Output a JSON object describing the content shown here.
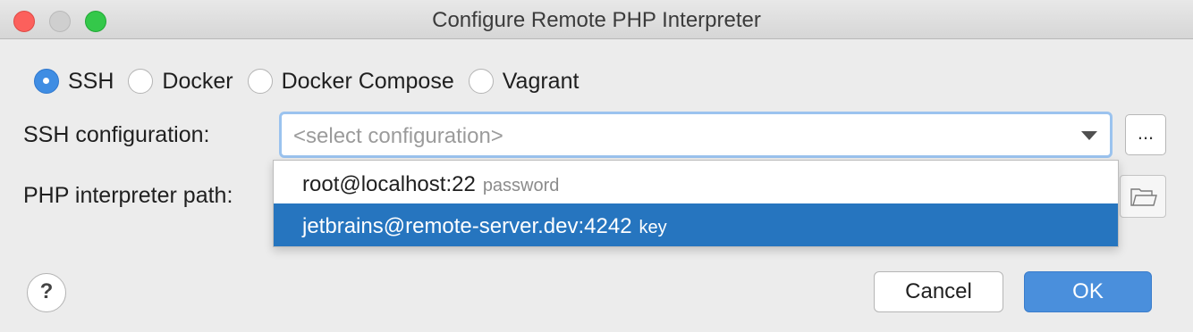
{
  "window": {
    "title": "Configure Remote PHP Interpreter"
  },
  "connection_types": {
    "options": [
      {
        "label": "SSH",
        "selected": true
      },
      {
        "label": "Docker",
        "selected": false
      },
      {
        "label": "Docker Compose",
        "selected": false
      },
      {
        "label": "Vagrant",
        "selected": false
      }
    ]
  },
  "ssh_configuration": {
    "label": "SSH configuration:",
    "placeholder": "<select configuration>",
    "browse_label": "..."
  },
  "php_interpreter": {
    "label": "PHP interpreter path:"
  },
  "dropdown": {
    "items": [
      {
        "name": "root@localhost:22",
        "auth": "password",
        "highlighted": false
      },
      {
        "name": "jetbrains@remote-server.dev:4242",
        "auth": "key",
        "highlighted": true
      }
    ]
  },
  "footer": {
    "help_label": "?",
    "cancel_label": "Cancel",
    "ok_label": "OK"
  },
  "colors": {
    "accent": "#4a8fdc",
    "selection": "#2675bf",
    "focus_ring": "#9bc3ef"
  },
  "icons": {
    "close": "close-icon",
    "minimize": "minimize-icon",
    "maximize": "maximize-icon",
    "combo_arrow": "chevron-down-icon",
    "folder": "folder-icon"
  }
}
